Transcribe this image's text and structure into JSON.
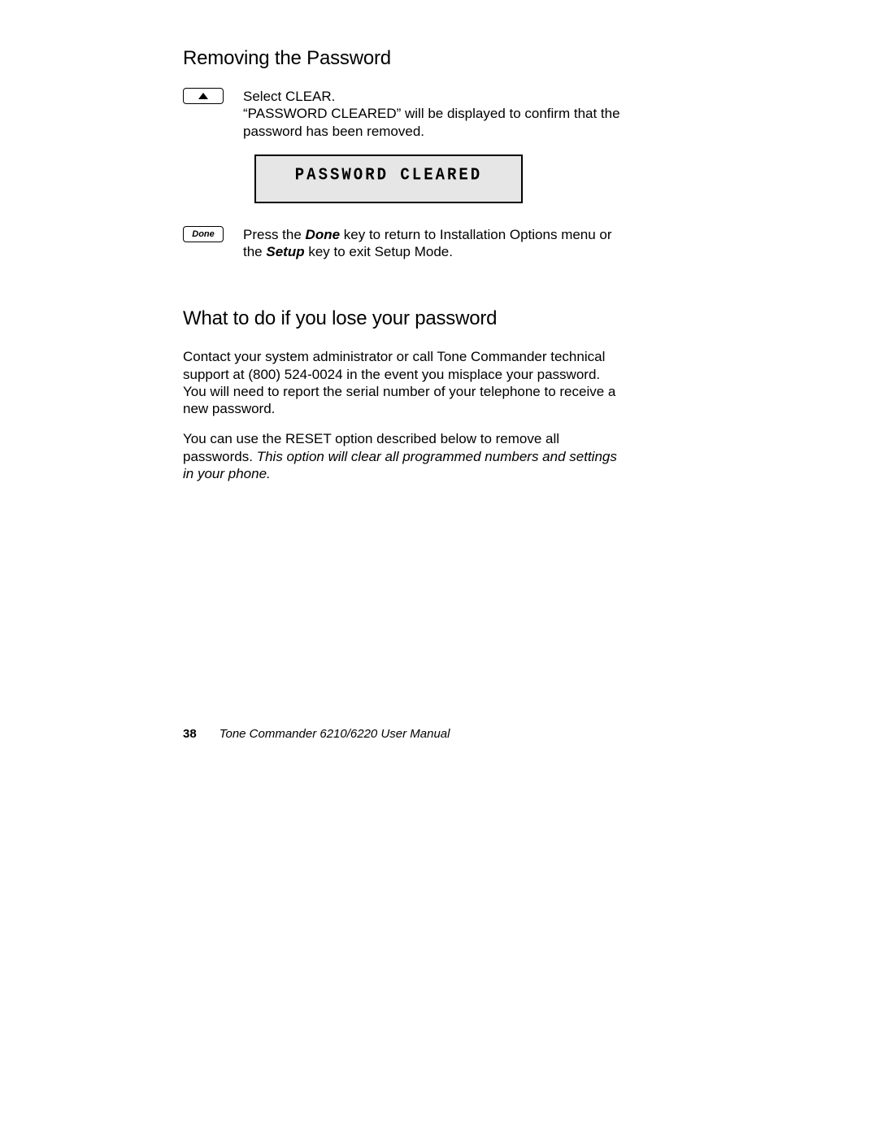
{
  "section1": {
    "heading": "Removing the Password",
    "step1_line1": "Select CLEAR.",
    "step1_line2": "“PASSWORD CLEARED” will be displayed to confirm that the password has been removed.",
    "lcd_text": "PASSWORD CLEARED",
    "step2_prefix": "Press the ",
    "step2_key": "Done",
    "step2_mid": " key to return to Installation Options menu or the ",
    "step2_key2": "Setup",
    "step2_suffix": " key to exit Setup Mode.",
    "done_key_label": "Done"
  },
  "section2": {
    "heading": "What to do if you lose your password",
    "para1": "Contact your system administrator or call Tone Commander technical support at (800) 524-0024 in the event you misplace your password. You will need to report the serial number of your telephone to receive a new password.",
    "para2_prefix": "You can use the RESET option described below to remove all passwords.  ",
    "para2_italic": "This option will clear all programmed numbers and settings in your phone."
  },
  "footer": {
    "page_number": "38",
    "manual_title": "Tone Commander 6210/6220 User Manual"
  }
}
